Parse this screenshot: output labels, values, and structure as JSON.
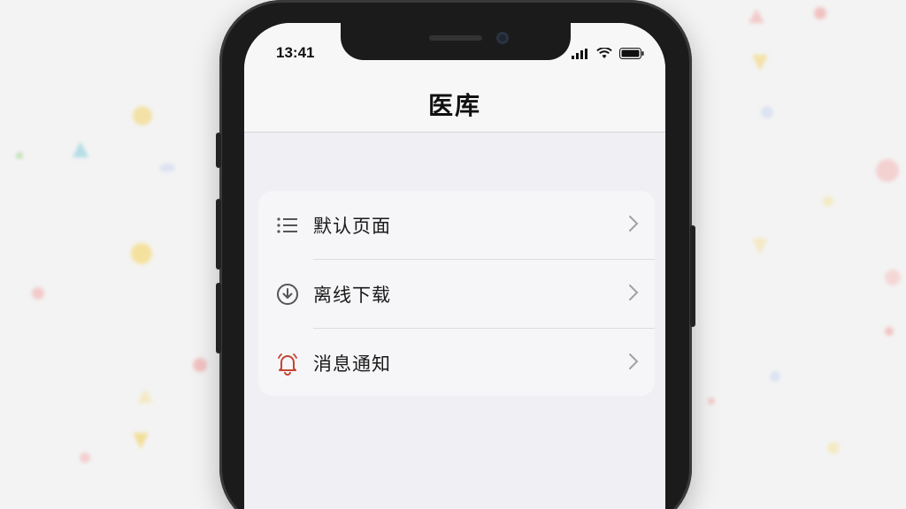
{
  "status_bar": {
    "time": "13:41"
  },
  "nav": {
    "title": "医库"
  },
  "menu": {
    "items": [
      {
        "label": "默认页面",
        "icon": "list-icon"
      },
      {
        "label": "离线下载",
        "icon": "download-circle-icon"
      },
      {
        "label": "消息通知",
        "icon": "bell-icon"
      }
    ]
  },
  "colors": {
    "bell_accent": "#c4452f",
    "icon_gray": "#555555",
    "chevron": "#a0a0a5"
  }
}
